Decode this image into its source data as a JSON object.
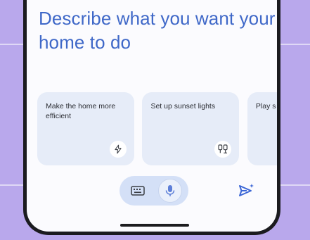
{
  "headline": "Describe what you want your home to do",
  "suggestions": [
    {
      "text": "Make the home more efficient",
      "icon": "bolt-icon"
    },
    {
      "text": "Set up sunset lights",
      "icon": "lights-icon"
    },
    {
      "text": "Play s when",
      "icon": ""
    }
  ],
  "input_bar": {
    "keyboard_icon": "keyboard-icon",
    "mic_icon": "mic-icon",
    "send_icon": "send-sparkle-icon"
  },
  "colors": {
    "background": "#b9a8ec",
    "headline": "#3f68c8",
    "card": "#e6ecf8",
    "pill": "#d4e0f7",
    "accent": "#3b66d6"
  }
}
